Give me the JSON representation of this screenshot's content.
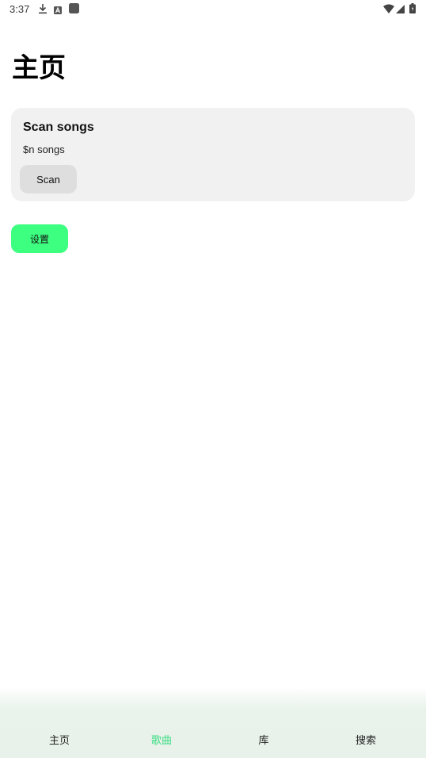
{
  "status_bar": {
    "time": "3:37",
    "icons": [
      "download-icon",
      "a-icon",
      "square-icon",
      "wifi-icon",
      "signal-icon",
      "battery-icon"
    ]
  },
  "page": {
    "title": "主页"
  },
  "scan_card": {
    "title": "Scan songs",
    "subtitle": "$n songs",
    "button_label": "Scan"
  },
  "settings_button": {
    "label": "设置"
  },
  "bottom_nav": {
    "active_color": "#3ddc84",
    "items": [
      {
        "label": "主页",
        "active": false
      },
      {
        "label": "歌曲",
        "active": true
      },
      {
        "label": "库",
        "active": false
      },
      {
        "label": "搜索",
        "active": false
      }
    ]
  },
  "colors": {
    "accent": "#3dff80",
    "card_background": "#f1f1f1",
    "nav_background": "#e8f2ea"
  }
}
